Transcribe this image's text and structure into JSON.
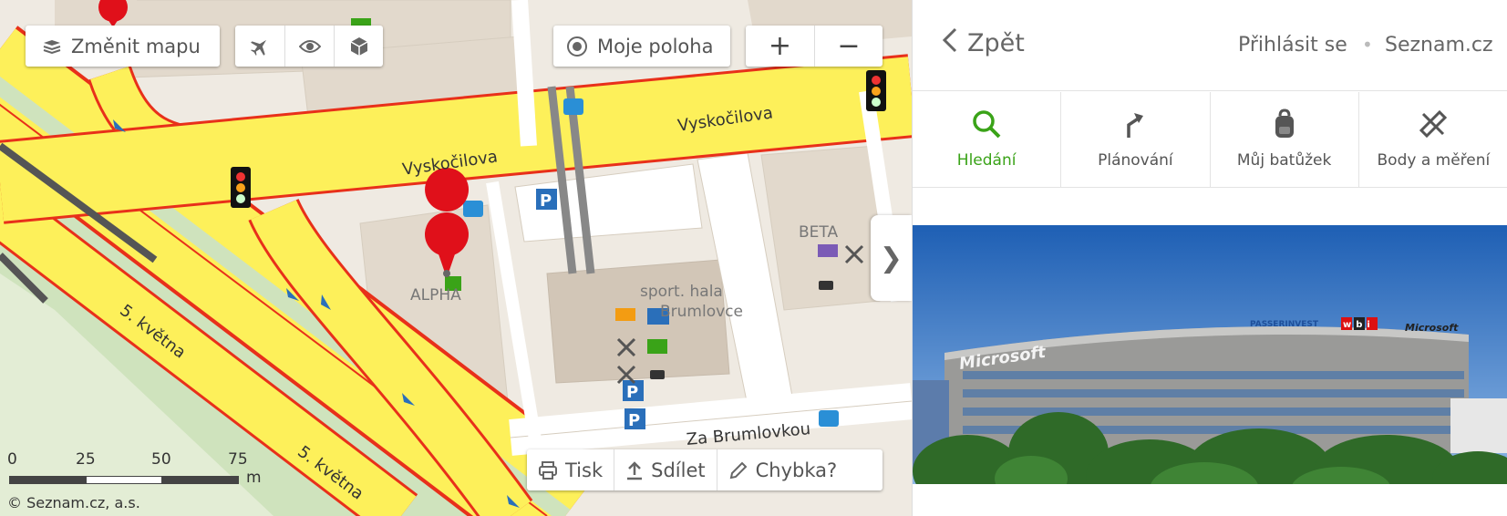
{
  "map": {
    "controls": {
      "change_map_label": "Změnit mapu",
      "my_location_label": "Moje poloha",
      "zoom_in_label": "+",
      "zoom_out_label": "−"
    },
    "bottom_tools": {
      "print_label": "Tisk",
      "share_label": "Sdílet",
      "error_label": "Chybka?"
    },
    "collapse_arrow": "❯",
    "streets": {
      "vyskocilova_1": "Vyskočilova",
      "vyskocilova_2": "Vyskočilova",
      "kvetna_1": "5. května",
      "kvetna_2": "5. května",
      "za_brumlovkou": "Za Brumlovkou"
    },
    "poi_labels": {
      "alpha": "ALPHA",
      "beta": "BETA",
      "sport_hala": "sport. hala",
      "brumlovce": "Brumlovce"
    },
    "scale": {
      "ticks": [
        "0",
        "25",
        "50",
        "75"
      ],
      "unit": "m"
    },
    "copyright": "© Seznam.cz, a.s.",
    "colors": {
      "main_road": "#fdf05a",
      "road_edge": "#e8301a",
      "green": "#cfe3bd",
      "background": "#efeae2",
      "building": "#e2d9cc",
      "marker": "#e0101a"
    }
  },
  "panel": {
    "back_label": "Zpět",
    "login_label": "Přihlásit se",
    "separator": "•",
    "seznam_label": "Seznam.cz",
    "tabs": [
      {
        "label": "Hledání",
        "icon": "search-icon",
        "active": true
      },
      {
        "label": "Plánování",
        "icon": "route-icon",
        "active": false
      },
      {
        "label": "Můj batůžek",
        "icon": "backpack-icon",
        "active": false
      },
      {
        "label": "Body a měření",
        "icon": "ruler-pencil-icon",
        "active": false
      }
    ],
    "photo_signs": {
      "left": "Microsoft",
      "right": "Microsoft",
      "passerinvest": "PASSERINVEST",
      "wbi": "wbi"
    },
    "colors": {
      "accent": "#3aa318"
    }
  }
}
